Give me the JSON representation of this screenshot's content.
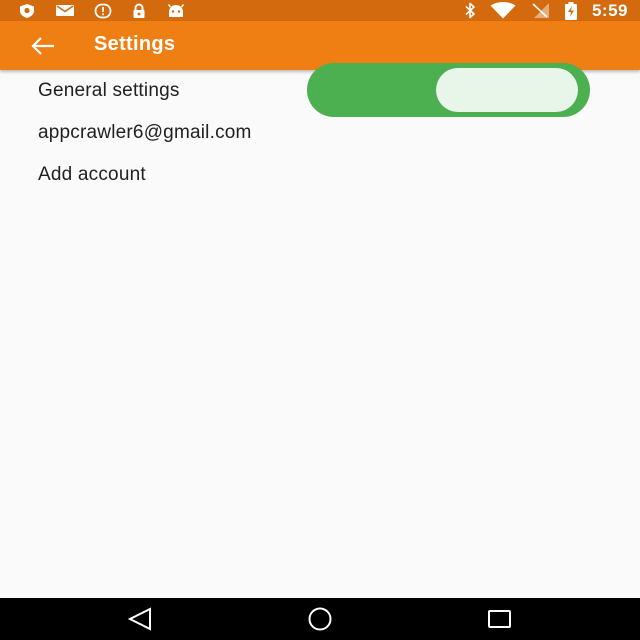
{
  "status_bar": {
    "time": "5:59",
    "left_icons": [
      "shield-icon",
      "email-icon",
      "alert-icon",
      "lock-icon",
      "android-icon"
    ],
    "right_icons": [
      "bluetooth-icon",
      "wifi-icon",
      "no-signal-icon",
      "battery-charging-icon"
    ],
    "color": "#d46a0e"
  },
  "app_bar": {
    "title": "Settings",
    "back_icon": "arrow-back-icon",
    "color": "#ef7f12"
  },
  "settings": {
    "items": [
      {
        "label": "General settings"
      },
      {
        "label": "appcrawler6@gmail.com"
      },
      {
        "label": "Add account"
      }
    ]
  },
  "toggle": {
    "state": "on",
    "track_color": "#4caf50",
    "thumb_color": "#e8f5e9"
  },
  "nav_bar": {
    "icons": [
      "nav-back-icon",
      "nav-home-icon",
      "nav-recents-icon"
    ]
  }
}
